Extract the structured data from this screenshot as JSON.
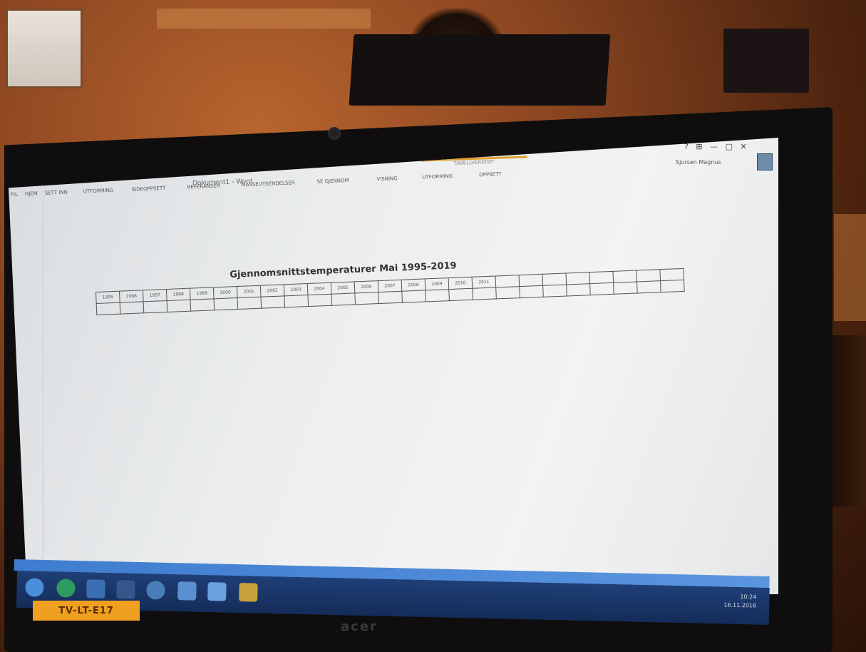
{
  "window": {
    "title": "Dokument1 - Word",
    "contextual_tab": "TABELLVERKTØY",
    "controls": [
      "?",
      "⊞",
      "—",
      "▢",
      "✕"
    ],
    "user": "Sjursen Magnus"
  },
  "ribbon": {
    "tabs": [
      "FIL",
      "HJEM",
      "SETT INN",
      "UTFORMING",
      "SIDEOPPSETT",
      "REFERANSER",
      "MASSEUTSENDELSER",
      "SE GJENNOM",
      "VISNING",
      "UTFORMING",
      "OPPSETT"
    ]
  },
  "document": {
    "title": "Gjennomsnittstemperaturer Mai 1995-2019",
    "years": [
      "1995",
      "1996",
      "1997",
      "1998",
      "1999",
      "2000",
      "2001",
      "2002",
      "2003",
      "2004",
      "2005",
      "2006",
      "2007",
      "2008",
      "2009",
      "2010",
      "2011",
      "",
      "",
      "",
      "",
      "",
      "",
      "",
      ""
    ]
  },
  "asset_label": "TV-LT-E17",
  "brand": "acer",
  "tray": {
    "time": "10:24",
    "date": "16.11.2016"
  }
}
